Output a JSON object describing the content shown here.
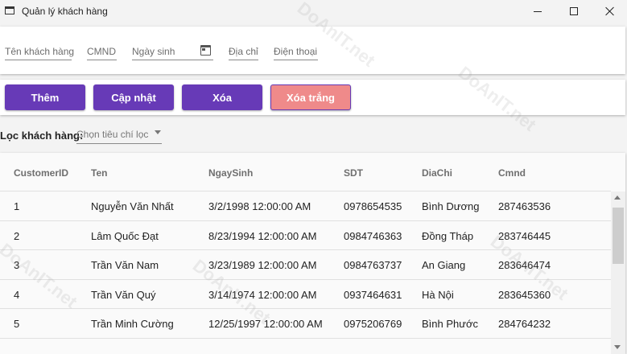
{
  "window": {
    "title": "Quản lý khách hàng"
  },
  "inputs": {
    "name_placeholder": "Tên khách hàng",
    "cmnd_placeholder": "CMND",
    "birthdate_placeholder": "Ngày sinh",
    "address_placeholder": "Địa chỉ",
    "phone_placeholder": "Điện thoại"
  },
  "buttons": {
    "add": "Thêm",
    "update": "Cập nhật",
    "delete": "Xóa",
    "clear": "Xóa trắng"
  },
  "filter": {
    "label": "Lọc khách hàng:",
    "placeholder": "Chọn tiêu chí lọc"
  },
  "table": {
    "columns": [
      "CustomerID",
      "Ten",
      "NgaySinh",
      "SDT",
      "DiaChi",
      "Cmnd"
    ],
    "rows": [
      [
        "1",
        "Nguyễn Văn Nhất",
        "3/2/1998 12:00:00 AM",
        "0978654535",
        "Bình Dương",
        "287463536"
      ],
      [
        "2",
        "Lâm Quốc Đạt",
        "8/23/1994 12:00:00 AM",
        "0984746363",
        "Đồng Tháp",
        "283746445"
      ],
      [
        "3",
        "Trần Văn Nam",
        "3/23/1989 12:00:00 AM",
        "0984763737",
        "An Giang",
        "283646474"
      ],
      [
        "4",
        "Trần Văn Quý",
        "3/14/1974 12:00:00 AM",
        "0937464631",
        "Hà Nội",
        "283645360"
      ],
      [
        "5",
        "Trần Minh Cường",
        "12/25/1997 12:00:00 AM",
        "0975206769",
        "Bình Phước",
        "284764232"
      ]
    ]
  },
  "watermark": {
    "text": "DoAnIT.net"
  },
  "colors": {
    "primary": "#673ab7",
    "clear_button": "#ef8a8a"
  }
}
